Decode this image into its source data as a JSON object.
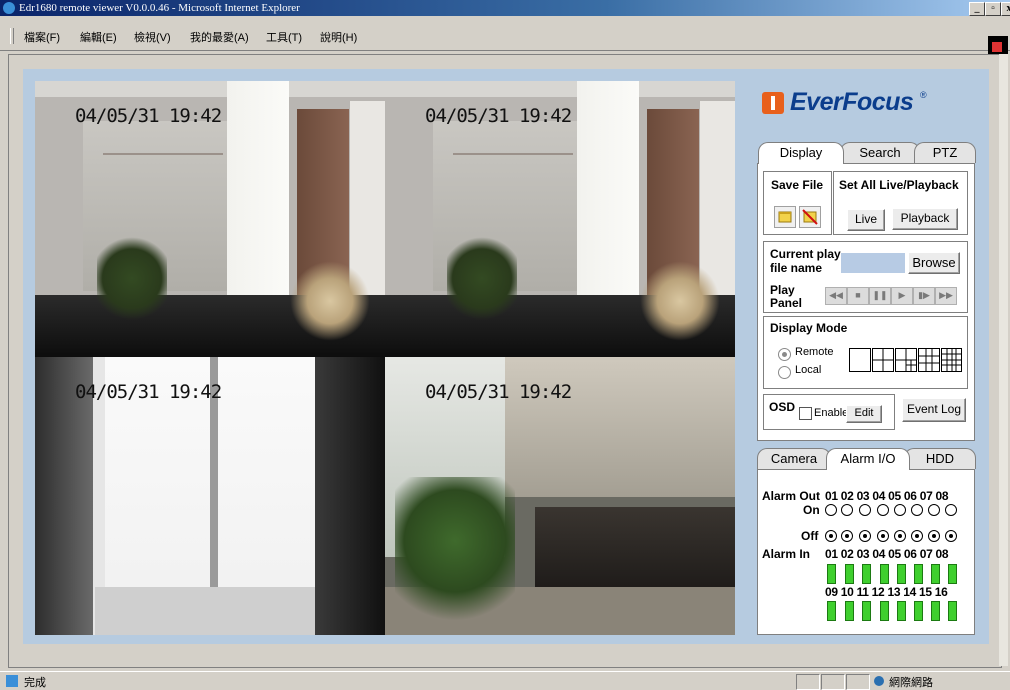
{
  "window": {
    "title": "Edr1680 remote viewer V0.0.0.46 - Microsoft Internet Explorer",
    "minimize": "_",
    "maximize": "▫",
    "close": "x"
  },
  "menu": [
    "檔案(F)",
    "編輯(E)",
    "檢視(V)",
    "我的最愛(A)",
    "工具(T)",
    "說明(H)"
  ],
  "status": {
    "text": "完成",
    "zone": "網際網路"
  },
  "cameras": [
    {
      "timestamp": "04/05/31 19:42"
    },
    {
      "timestamp": "04/05/31 19:42"
    },
    {
      "timestamp": "04/05/31 19:42"
    },
    {
      "timestamp": "04/05/31 19:42"
    }
  ],
  "logo": {
    "text": "EverFocus",
    "reg": "®"
  },
  "tabs_top": [
    {
      "label": "Display",
      "active": true
    },
    {
      "label": "Search",
      "active": false
    },
    {
      "label": "PTZ",
      "active": false
    }
  ],
  "display": {
    "save_file": "Save File",
    "set_all": "Set All Live/Playback",
    "live": "Live",
    "playback": "Playback",
    "current_play_1": "Current play",
    "current_play_2": "file name",
    "browse": "Browse",
    "play_panel_1": "Play",
    "play_panel_2": "Panel",
    "display_mode": "Display Mode",
    "remote": "Remote",
    "local": "Local",
    "osd": "OSD",
    "enable": "Enable",
    "edit": "Edit",
    "event_log": "Event Log"
  },
  "tabs_bottom": [
    {
      "label": "Camera",
      "active": false
    },
    {
      "label": "Alarm I/O",
      "active": true
    },
    {
      "label": "HDD",
      "active": false
    }
  ],
  "alarm": {
    "out_label": "Alarm Out",
    "on_label": "On",
    "off_label": "Off",
    "in_label": "Alarm In",
    "out_numbers": "01 02 03 04 05 06 07 08",
    "in_numbers_1": "01 02 03 04 05 06 07 08",
    "in_numbers_2": "09 10 11 12 13 14 15 16",
    "selected_state": "Off"
  }
}
